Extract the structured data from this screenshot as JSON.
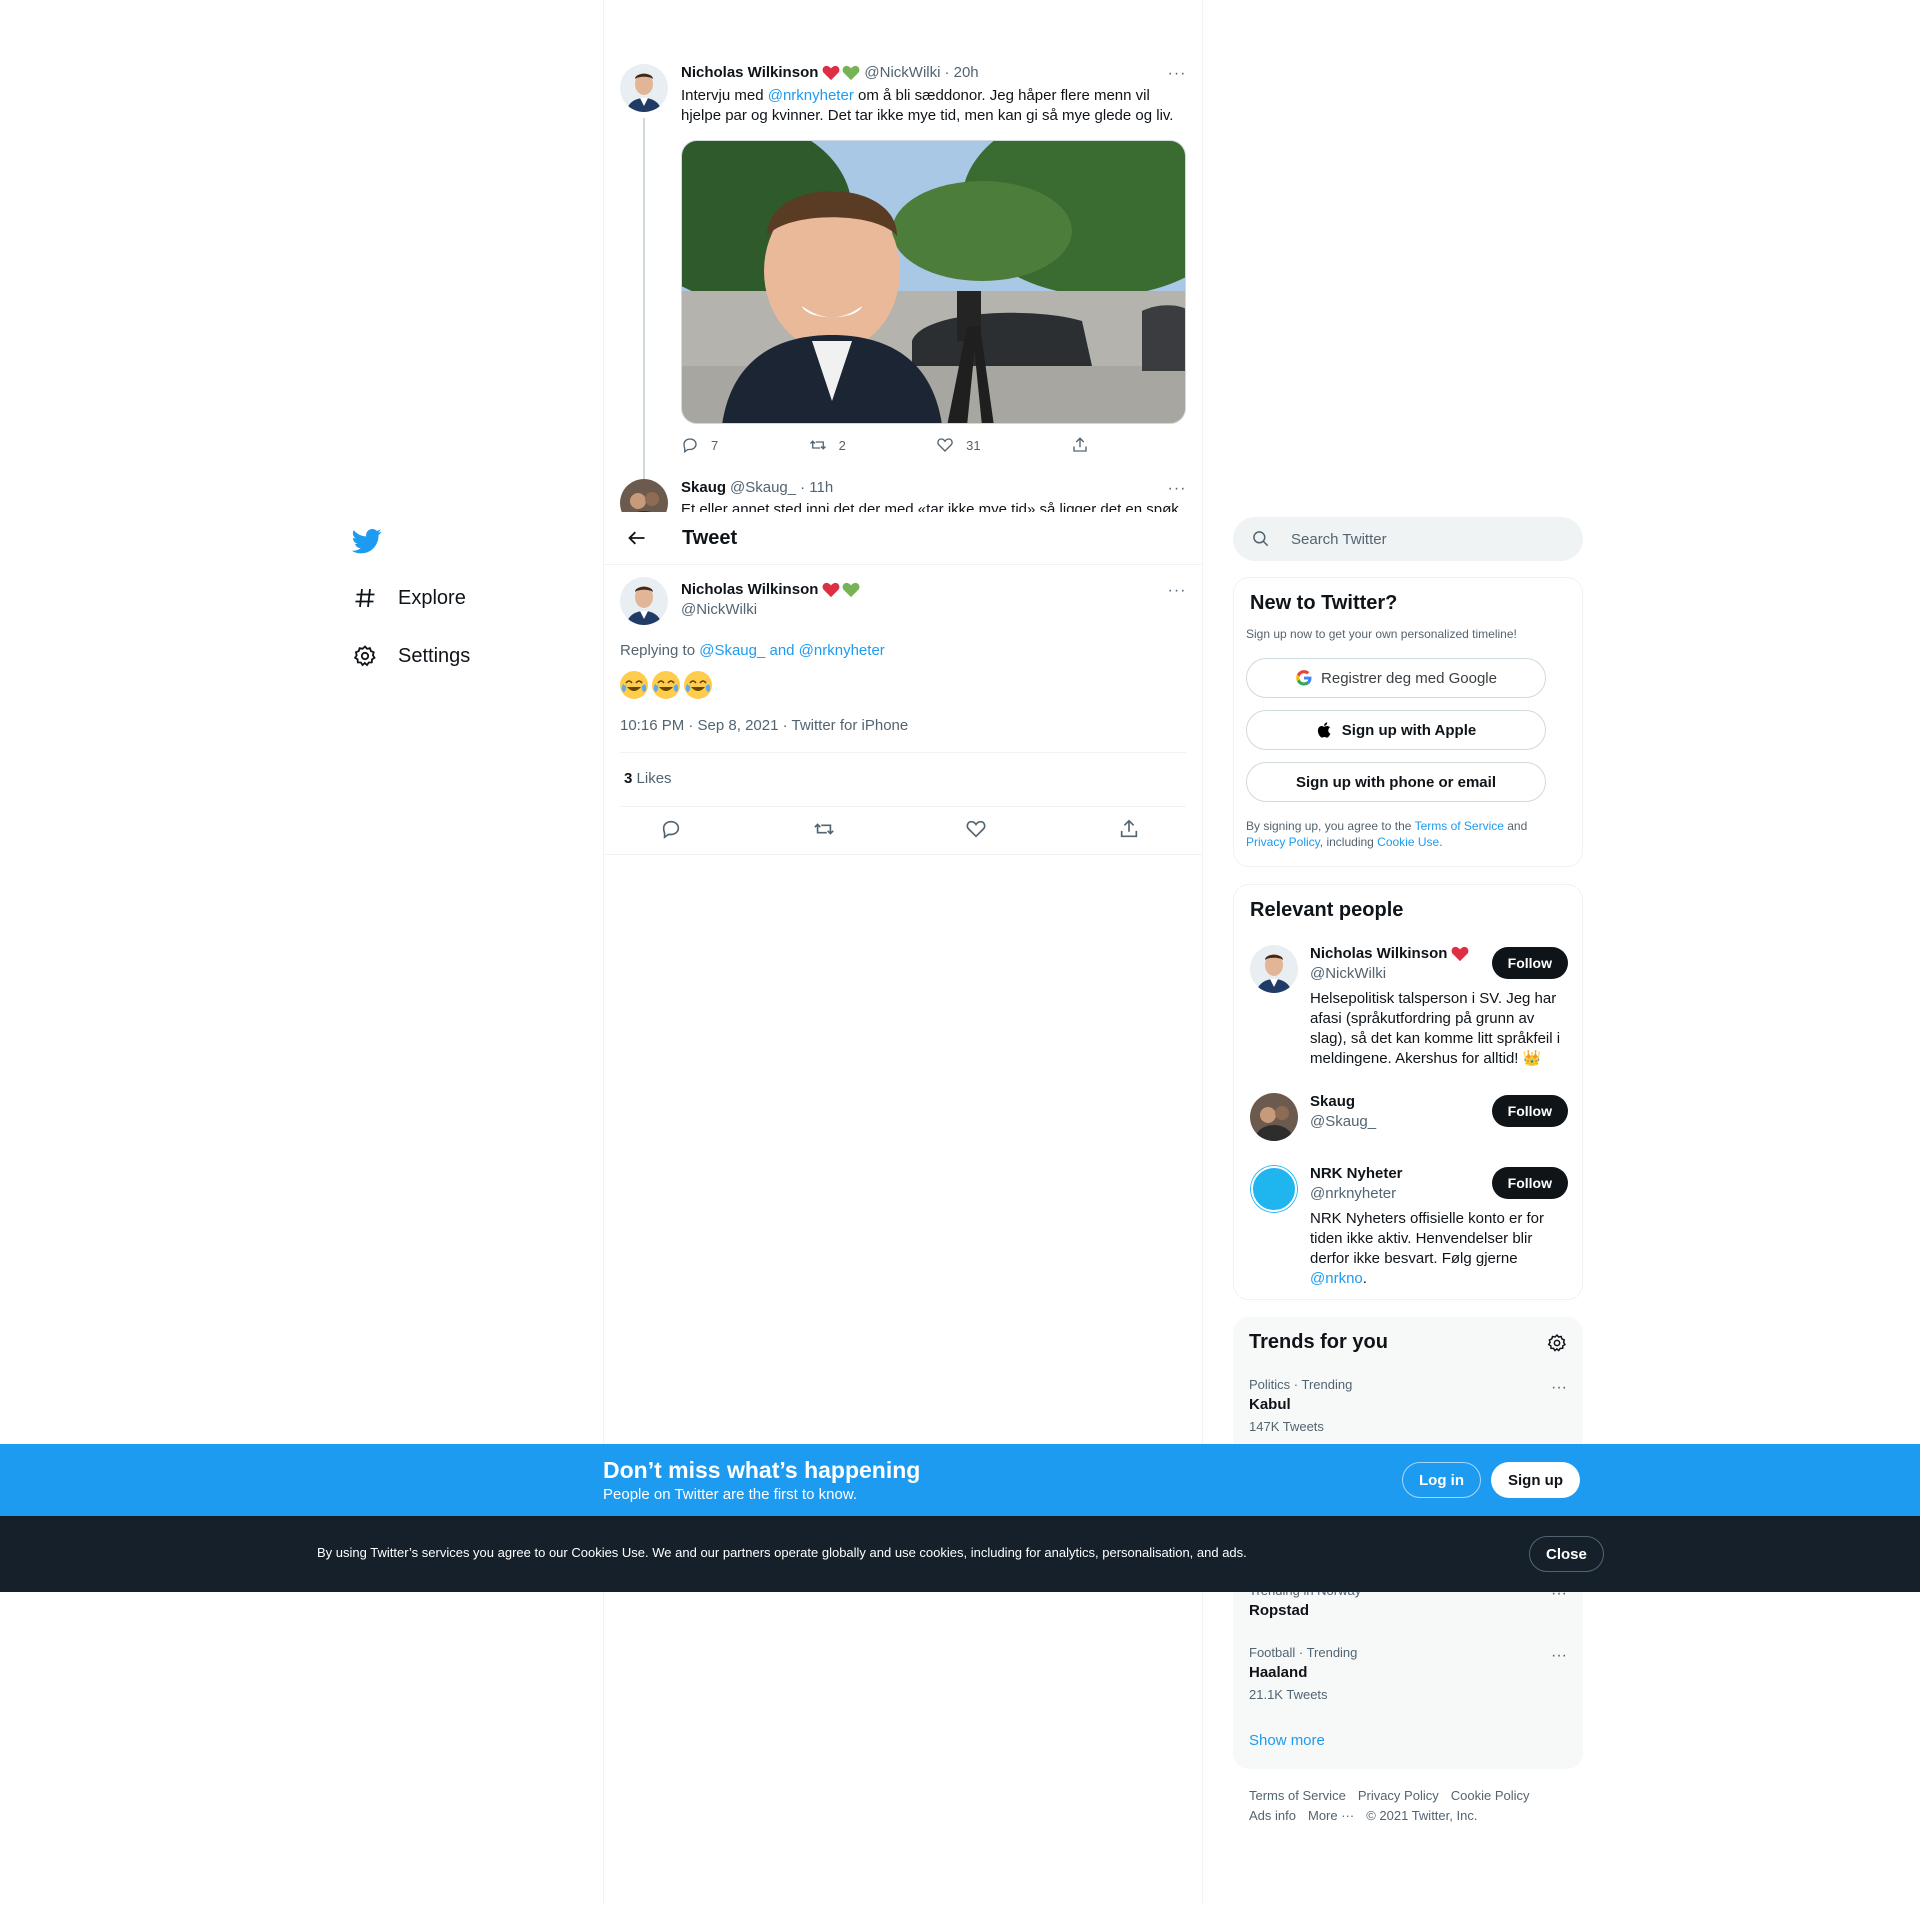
{
  "nav": {
    "items": [
      {
        "label": "Explore",
        "icon": "hashtag-icon"
      },
      {
        "label": "Settings",
        "icon": "gear-icon"
      }
    ]
  },
  "thread": {
    "tweet1": {
      "name": "Nicholas Wilkinson",
      "handle": "@NickWilki",
      "time": "· 20h",
      "text_before": "Intervju med ",
      "mention": "@nrknyheter",
      "text_after": " om å bli sæddonor. Jeg håper flere menn vil hjelpe par og kvinner. Det tar ikke mye tid, men kan gi så mye glede og liv.",
      "replies": "7",
      "retweets": "2",
      "likes": "31"
    },
    "tweet2": {
      "name": "Skaug",
      "handle": "@Skaug_",
      "time": "· 11h",
      "text": "Et eller annet sted inni det der med «tar ikke mye tid» så ligger det en spøk"
    }
  },
  "header": {
    "title": "Tweet"
  },
  "main_tweet": {
    "name": "Nicholas Wilkinson",
    "handle": "@NickWilki",
    "replying_prefix": "Replying to ",
    "replying_to": "@Skaug_ and @nrknyheter",
    "timestamp": "10:16 PM · Sep 8, 2021 · Twitter for iPhone",
    "likes_count": "3",
    "likes_label": "Likes"
  },
  "search": {
    "placeholder": "Search Twitter"
  },
  "signup": {
    "title": "New to Twitter?",
    "subtitle": "Sign up now to get your own personalized timeline!",
    "google": "Registrer deg med Google",
    "apple": "Sign up with Apple",
    "phone": "Sign up with phone or email",
    "legal_1": "By signing up, you agree to the ",
    "terms": "Terms of Service",
    "legal_2": " and ",
    "privacy": "Privacy Policy",
    "legal_3": ", including ",
    "cookie": "Cookie Use",
    "legal_4": "."
  },
  "relevant": {
    "title": "Relevant people",
    "follow_label": "Follow",
    "people": [
      {
        "name": "Nicholas Wilkinson",
        "handle": "@NickWilki",
        "bio": "Helsepolitisk talsperson i SV. Jeg har afasi (språkutfordring på grunn av slag), så det kan komme litt språkfeil i meldingene. Akershus for alltid! 👑"
      },
      {
        "name": "Skaug",
        "handle": "@Skaug_",
        "bio": ""
      },
      {
        "name": "NRK Nyheter",
        "handle": "@nrknyheter",
        "bio": "NRK Nyheters offisielle konto er for tiden ikke aktiv. Henvendelser blir derfor ikke besvart. Følg gjerne ",
        "bio_link": "@nrkno",
        "bio_end": "."
      }
    ]
  },
  "trends": {
    "title": "Trends for you",
    "items": [
      {
        "meta": "Politics · Trending",
        "name": "Kabul",
        "count": "147K Tweets"
      },
      {
        "meta": "Trending in Norway",
        "name": "Ropstad",
        "count": ""
      },
      {
        "meta": "Football · Trending",
        "name": "Haaland",
        "count": "21.1K Tweets"
      }
    ],
    "show_more": "Show more"
  },
  "footer": {
    "links": [
      "Terms of Service",
      "Privacy Policy",
      "Cookie Policy",
      "Ads info",
      "More ···",
      "© 2021 Twitter, Inc."
    ]
  },
  "banner": {
    "title": "Don’t miss what’s happening",
    "subtitle": "People on Twitter are the first to know.",
    "login": "Log in",
    "signup": "Sign up"
  },
  "cookie_bar": {
    "text": "By using Twitter’s services you agree to our Cookies Use. We and our partners operate globally and use cookies, including for analytics, personalisation, and ads.",
    "close": "Close"
  },
  "colors": {
    "accent": "#1d9bf0",
    "dark": "#0f1419",
    "muted": "#536471",
    "cookie_bg": "#15202b"
  }
}
